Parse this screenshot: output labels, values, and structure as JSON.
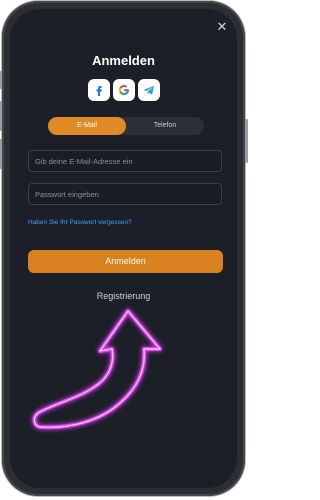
{
  "header": {
    "title": "Anmelden",
    "close_icon": "close-icon",
    "close_symbol": "✕"
  },
  "social": [
    {
      "name": "facebook",
      "icon": "facebook-icon",
      "color": "#1877f2"
    },
    {
      "name": "google",
      "icon": "google-icon"
    },
    {
      "name": "telegram",
      "icon": "telegram-icon",
      "color": "#2aa3df"
    }
  ],
  "tabs": [
    {
      "label": "E-Mail",
      "active": true
    },
    {
      "label": "Telefon",
      "active": false
    }
  ],
  "form": {
    "email_placeholder": "Gib deine E-Mail-Adresse ein",
    "email_value": "",
    "password_placeholder": "Passwort eingeben",
    "password_value": "",
    "forgot_link": "Haben Sie Ihr Passwort vergessen?",
    "submit_label": "Anmelden"
  },
  "register_link": "Registrierung",
  "colors": {
    "accent": "#e08a26",
    "screen_bg": "#1c1f27",
    "link": "#3aa0ff",
    "arrow_glow": "#e040fb"
  }
}
